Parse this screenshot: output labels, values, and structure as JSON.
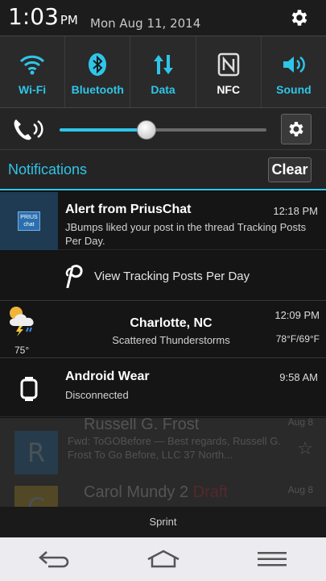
{
  "status": {
    "time": "1:03",
    "ampm": "PM",
    "date": "Mon Aug 11, 2014",
    "icons": {
      "settings": "gear-icon"
    }
  },
  "quick_settings": [
    {
      "label": "Wi-Fi",
      "icon": "wifi-icon",
      "active": true
    },
    {
      "label": "Bluetooth",
      "icon": "bluetooth-icon",
      "active": true
    },
    {
      "label": "Data",
      "icon": "data-icon",
      "active": true
    },
    {
      "label": "NFC",
      "icon": "nfc-icon",
      "active": false
    },
    {
      "label": "Sound",
      "icon": "sound-icon",
      "active": true
    }
  ],
  "volume": {
    "level": 0.42,
    "icons": {
      "ringer": "ringer-icon",
      "settings": "gear-icon"
    }
  },
  "notifications_header": {
    "title": "Notifications",
    "clear_label": "Clear"
  },
  "notifications": [
    {
      "title": "Alert from PriusChat",
      "time": "12:18 PM",
      "body": "JBumps liked your post in the thread Tracking Posts Per Day.",
      "logo_text": "PRIUS chat",
      "action_label": "View Tracking Posts Per Day"
    },
    {
      "city": "Charlotte, NC",
      "time": "12:09 PM",
      "condition": "Scattered Thunderstorms",
      "temp": "75°",
      "hilo": "78°F/69°F"
    },
    {
      "title": "Android Wear",
      "time": "9:58 AM",
      "body": "Disconnected"
    }
  ],
  "background_app": [
    {
      "avatar_letter": "R",
      "name": "Russell G. Frost",
      "date": "Aug 8",
      "snippet": "Fwd: ToGOBefore — Best regards, Russell G. Frost To Go Before, LLC 37 North..."
    },
    {
      "avatar_letter": "C",
      "name": "Carol Mundy",
      "count": "2",
      "draft": "Draft",
      "date": "Aug 8"
    }
  ],
  "carrier": "Sprint",
  "colors": {
    "accent": "#2fc5e8"
  }
}
